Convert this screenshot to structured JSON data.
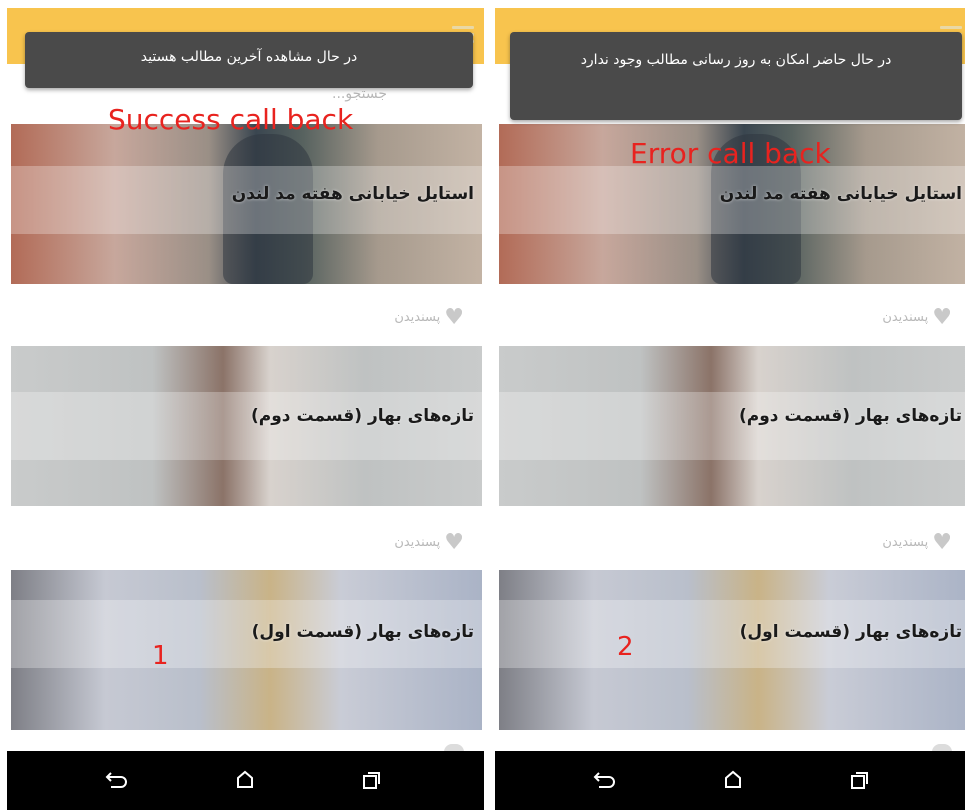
{
  "colors": {
    "appbar": "#f8c44e",
    "toast": "#4a4a4a",
    "annotation": "#e8231f",
    "navbar": "#000000"
  },
  "screens": [
    {
      "toast": "در حال مشاهده آخرین مطالب هستید",
      "callback_label": "Success call back",
      "number": "1"
    },
    {
      "toast": "در حال حاضر امکان به روز رسانی مطالب وجود ندارد",
      "callback_label": "Error call back",
      "number": "2"
    }
  ],
  "search_placeholder": "جستجو...",
  "cards": [
    {
      "title": "استایل خیابانی هفته مد لندن",
      "like": "پسندیدن"
    },
    {
      "title": "تازه‌های بهار (قسمت دوم)",
      "like": "پسندیدن"
    },
    {
      "title": "تازه‌های بهار (قسمت اول)"
    }
  ],
  "nav_icons": [
    "back-icon",
    "home-icon",
    "recents-icon"
  ]
}
